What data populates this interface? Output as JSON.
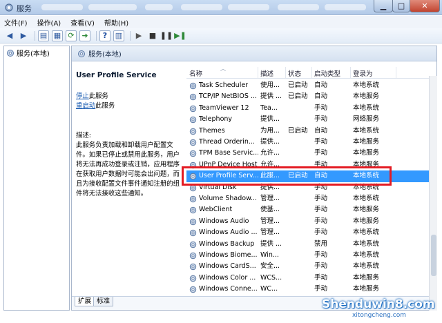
{
  "window": {
    "title": "服务"
  },
  "menu": [
    "文件(F)",
    "操作(A)",
    "查看(V)",
    "帮助(H)"
  ],
  "tree": {
    "root_label": "服务(本地)"
  },
  "panel": {
    "header": "服务(本地)"
  },
  "description": {
    "service_name": "User Profile Service",
    "stop_link": "停止",
    "stop_suffix": "此服务",
    "restart_link": "重启动",
    "restart_suffix": "此服务",
    "label": "描述:",
    "text": "此服务负责加载和卸载用户配置文件。如果已停止或禁用此服务，用户将无法再成功登录或注销，应用程序在获取用户数据时可能会出问题，而且为接收配置文件事件通知注册的组件将无法接收这些通知。"
  },
  "list": {
    "columns": [
      "名称",
      "描述",
      "状态",
      "启动类型",
      "登录为"
    ],
    "rows": [
      {
        "name": "Task Scheduler",
        "desc": "使用...",
        "status": "已启动",
        "startup": "自动",
        "logon": "本地系统"
      },
      {
        "name": "TCP/IP NetBIOS ...",
        "desc": "提供 ...",
        "status": "已启动",
        "startup": "自动",
        "logon": "本地服务"
      },
      {
        "name": "TeamViewer 12",
        "desc": "Tea...",
        "status": "",
        "startup": "手动",
        "logon": "本地系统"
      },
      {
        "name": "Telephony",
        "desc": "提供...",
        "status": "",
        "startup": "手动",
        "logon": "网络服务"
      },
      {
        "name": "Themes",
        "desc": "为用...",
        "status": "已启动",
        "startup": "自动",
        "logon": "本地系统"
      },
      {
        "name": "Thread Orderin...",
        "desc": "提供...",
        "status": "",
        "startup": "手动",
        "logon": "本地服务"
      },
      {
        "name": "TPM Base Servic...",
        "desc": "允许...",
        "status": "",
        "startup": "手动",
        "logon": "本地服务"
      },
      {
        "name": "UPnP Device Host",
        "desc": "允许...",
        "status": "",
        "startup": "手动",
        "logon": "本地服务"
      },
      {
        "name": "User Profile Serv...",
        "desc": "此服...",
        "status": "已启动",
        "startup": "自动",
        "logon": "本地系统"
      },
      {
        "name": "Virtual Disk",
        "desc": "提供...",
        "status": "",
        "startup": "手动",
        "logon": "本地系统"
      },
      {
        "name": "Volume Shadow...",
        "desc": "管理...",
        "status": "",
        "startup": "手动",
        "logon": "本地系统"
      },
      {
        "name": "WebClient",
        "desc": "使基...",
        "status": "",
        "startup": "手动",
        "logon": "本地服务"
      },
      {
        "name": "Windows Audio",
        "desc": "管理...",
        "status": "",
        "startup": "手动",
        "logon": "本地服务"
      },
      {
        "name": "Windows Audio ...",
        "desc": "管理...",
        "status": "",
        "startup": "手动",
        "logon": "本地系统"
      },
      {
        "name": "Windows Backup",
        "desc": "提供 ...",
        "status": "",
        "startup": "禁用",
        "logon": "本地系统"
      },
      {
        "name": "Windows Biome...",
        "desc": "Win...",
        "status": "",
        "startup": "手动",
        "logon": "本地系统"
      },
      {
        "name": "Windows CardS...",
        "desc": "安全...",
        "status": "",
        "startup": "手动",
        "logon": "本地系统"
      },
      {
        "name": "Windows Color ...",
        "desc": "WCS...",
        "status": "",
        "startup": "手动",
        "logon": "本地服务"
      },
      {
        "name": "Windows Conne...",
        "desc": "WC...",
        "status": "",
        "startup": "手动",
        "logon": "本地服务"
      }
    ],
    "selected_index": 8
  },
  "tabs": [
    "扩展",
    "标准"
  ],
  "watermark": {
    "main": "Shenduwin8.com",
    "sub": "xitongcheng.com"
  },
  "colors": {
    "selection": "#3399ff",
    "highlight_box": "#e31b23",
    "link": "#1558b0"
  }
}
